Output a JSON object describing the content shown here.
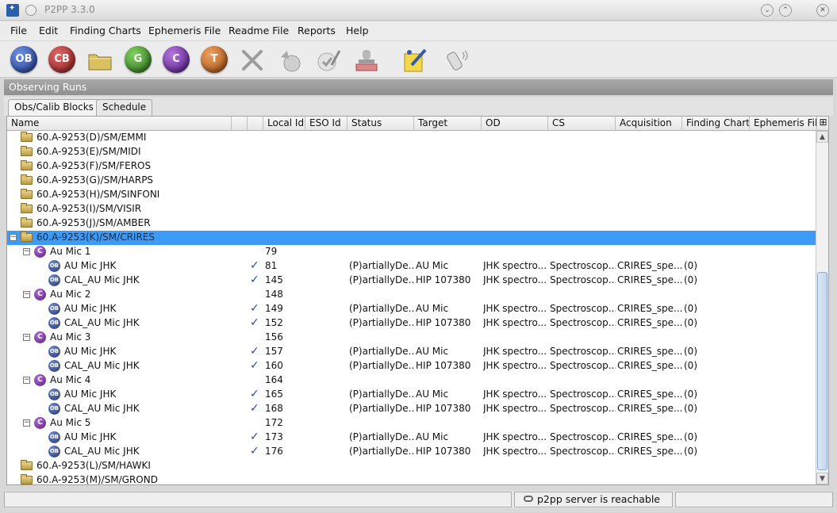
{
  "window": {
    "title": "P2PP 3.3.0"
  },
  "menu": [
    "File",
    "Edit",
    "Finding Charts",
    "Ephemeris File",
    "Readme File",
    "Reports",
    "Help"
  ],
  "toolbar": {
    "buttons": [
      {
        "label": "OB",
        "color": "#2f4fa8"
      },
      {
        "label": "CB",
        "color": "#a82a2a"
      },
      {
        "label": "G",
        "color": "#3a8a2a"
      },
      {
        "label": "C",
        "color": "#6b2aa8"
      },
      {
        "label": "T",
        "color": "#c46a1e"
      }
    ]
  },
  "panel": {
    "title": "Observing Runs"
  },
  "tabs": [
    "Obs/Calib Blocks",
    "Schedule"
  ],
  "columns": [
    "Name",
    "Local Id",
    "ESO Id",
    "Status",
    "Target",
    "OD",
    "CS",
    "Acquisition",
    "Finding Charts",
    "Ephemeris File"
  ],
  "rows": [
    {
      "kind": "folder",
      "name": "60.A-9253(D)/SM/EMMI"
    },
    {
      "kind": "folder",
      "name": "60.A-9253(E)/SM/MIDI"
    },
    {
      "kind": "folder",
      "name": "60.A-9253(F)/SM/FEROS"
    },
    {
      "kind": "folder",
      "name": "60.A-9253(G)/SM/HARPS"
    },
    {
      "kind": "folder",
      "name": "60.A-9253(H)/SM/SINFONI"
    },
    {
      "kind": "folder",
      "name": "60.A-9253(I)/SM/VISIR"
    },
    {
      "kind": "folder",
      "name": "60.A-9253(J)/SM/AMBER"
    },
    {
      "kind": "folder-open",
      "name": "60.A-9253(K)/SM/CRIRES",
      "selected": true
    },
    {
      "kind": "container",
      "name": "Au Mic 1",
      "local_id": "79"
    },
    {
      "kind": "ob",
      "name": "AU Mic JHK",
      "local_id": "81",
      "status": "(P)artiallyDe...",
      "target": "AU Mic",
      "od": "JHK spectro...",
      "cs": "Spectroscop...",
      "acq": "CRIRES_spe...",
      "fc": "(0)"
    },
    {
      "kind": "ob",
      "name": "CAL_AU Mic JHK",
      "local_id": "145",
      "status": "(P)artiallyDe...",
      "target": "HIP 107380",
      "od": "JHK spectro...",
      "cs": "Spectroscop...",
      "acq": "CRIRES_spe...",
      "fc": "(0)"
    },
    {
      "kind": "container",
      "name": "Au Mic 2",
      "local_id": "148"
    },
    {
      "kind": "ob",
      "name": "AU Mic JHK",
      "local_id": "149",
      "status": "(P)artiallyDe...",
      "target": "AU Mic",
      "od": "JHK spectro...",
      "cs": "Spectroscop...",
      "acq": "CRIRES_spe...",
      "fc": "(0)"
    },
    {
      "kind": "ob",
      "name": "CAL_AU Mic JHK",
      "local_id": "152",
      "status": "(P)artiallyDe...",
      "target": "HIP 107380",
      "od": "JHK spectro...",
      "cs": "Spectroscop...",
      "acq": "CRIRES_spe...",
      "fc": "(0)"
    },
    {
      "kind": "container",
      "name": "Au Mic 3",
      "local_id": "156"
    },
    {
      "kind": "ob",
      "name": "AU Mic JHK",
      "local_id": "157",
      "status": "(P)artiallyDe...",
      "target": "AU Mic",
      "od": "JHK spectro...",
      "cs": "Spectroscop...",
      "acq": "CRIRES_spe...",
      "fc": "(0)"
    },
    {
      "kind": "ob",
      "name": "CAL_AU Mic JHK",
      "local_id": "160",
      "status": "(P)artiallyDe...",
      "target": "HIP 107380",
      "od": "JHK spectro...",
      "cs": "Spectroscop...",
      "acq": "CRIRES_spe...",
      "fc": "(0)"
    },
    {
      "kind": "container",
      "name": "Au Mic 4",
      "local_id": "164"
    },
    {
      "kind": "ob",
      "name": "AU Mic JHK",
      "local_id": "165",
      "status": "(P)artiallyDe...",
      "target": "AU Mic",
      "od": "JHK spectro...",
      "cs": "Spectroscop...",
      "acq": "CRIRES_spe...",
      "fc": "(0)"
    },
    {
      "kind": "ob",
      "name": "CAL_AU Mic JHK",
      "local_id": "168",
      "status": "(P)artiallyDe...",
      "target": "HIP 107380",
      "od": "JHK spectro...",
      "cs": "Spectroscop...",
      "acq": "CRIRES_spe...",
      "fc": "(0)"
    },
    {
      "kind": "container",
      "name": "Au Mic 5",
      "local_id": "172"
    },
    {
      "kind": "ob",
      "name": "AU Mic JHK",
      "local_id": "173",
      "status": "(P)artiallyDe...",
      "target": "AU Mic",
      "od": "JHK spectro...",
      "cs": "Spectroscop...",
      "acq": "CRIRES_spe...",
      "fc": "(0)"
    },
    {
      "kind": "ob",
      "name": "CAL_AU Mic JHK",
      "local_id": "176",
      "status": "(P)artiallyDe...",
      "target": "HIP 107380",
      "od": "JHK spectro...",
      "cs": "Spectroscop...",
      "acq": "CRIRES_spe...",
      "fc": "(0)"
    },
    {
      "kind": "folder",
      "name": "60.A-9253(L)/SM/HAWKI"
    },
    {
      "kind": "folder",
      "name": "60.A-9253(M)/SM/GROND"
    }
  ],
  "status": {
    "text": "p2pp server is reachable"
  },
  "colors": {
    "selection": "#3d9bf5",
    "check": "#1e4bb5"
  }
}
